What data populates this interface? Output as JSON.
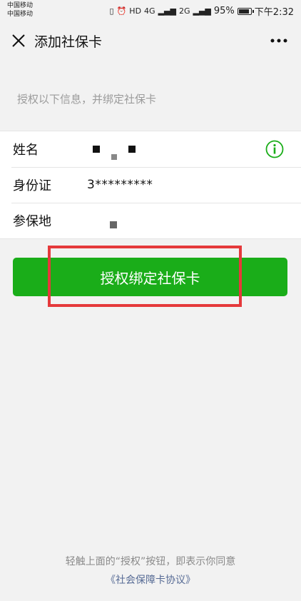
{
  "status_bar": {
    "carrier_1": "中国移动",
    "carrier_2": "中国移动",
    "network_1": "4G",
    "network_2": "2G",
    "battery": "95%",
    "time": "下午2:32"
  },
  "nav": {
    "title": "添加社保卡",
    "close_icon": "close-icon",
    "more_icon": "more-icon"
  },
  "hint": "授权以下信息，并绑定社保卡",
  "info": {
    "rows": [
      {
        "label": "姓名",
        "value": ""
      },
      {
        "label": "身份证",
        "value": "3*********"
      },
      {
        "label": "参保地",
        "value": ""
      }
    ]
  },
  "bind_button": {
    "label": "授权绑定社保卡"
  },
  "footer": {
    "notice": "轻触上面的“授权”按钮，即表示你同意",
    "agreement": "《社会保障卡协议》"
  },
  "colors": {
    "accent": "#1aad19",
    "highlight": "#e5393b",
    "link": "#576b95"
  }
}
